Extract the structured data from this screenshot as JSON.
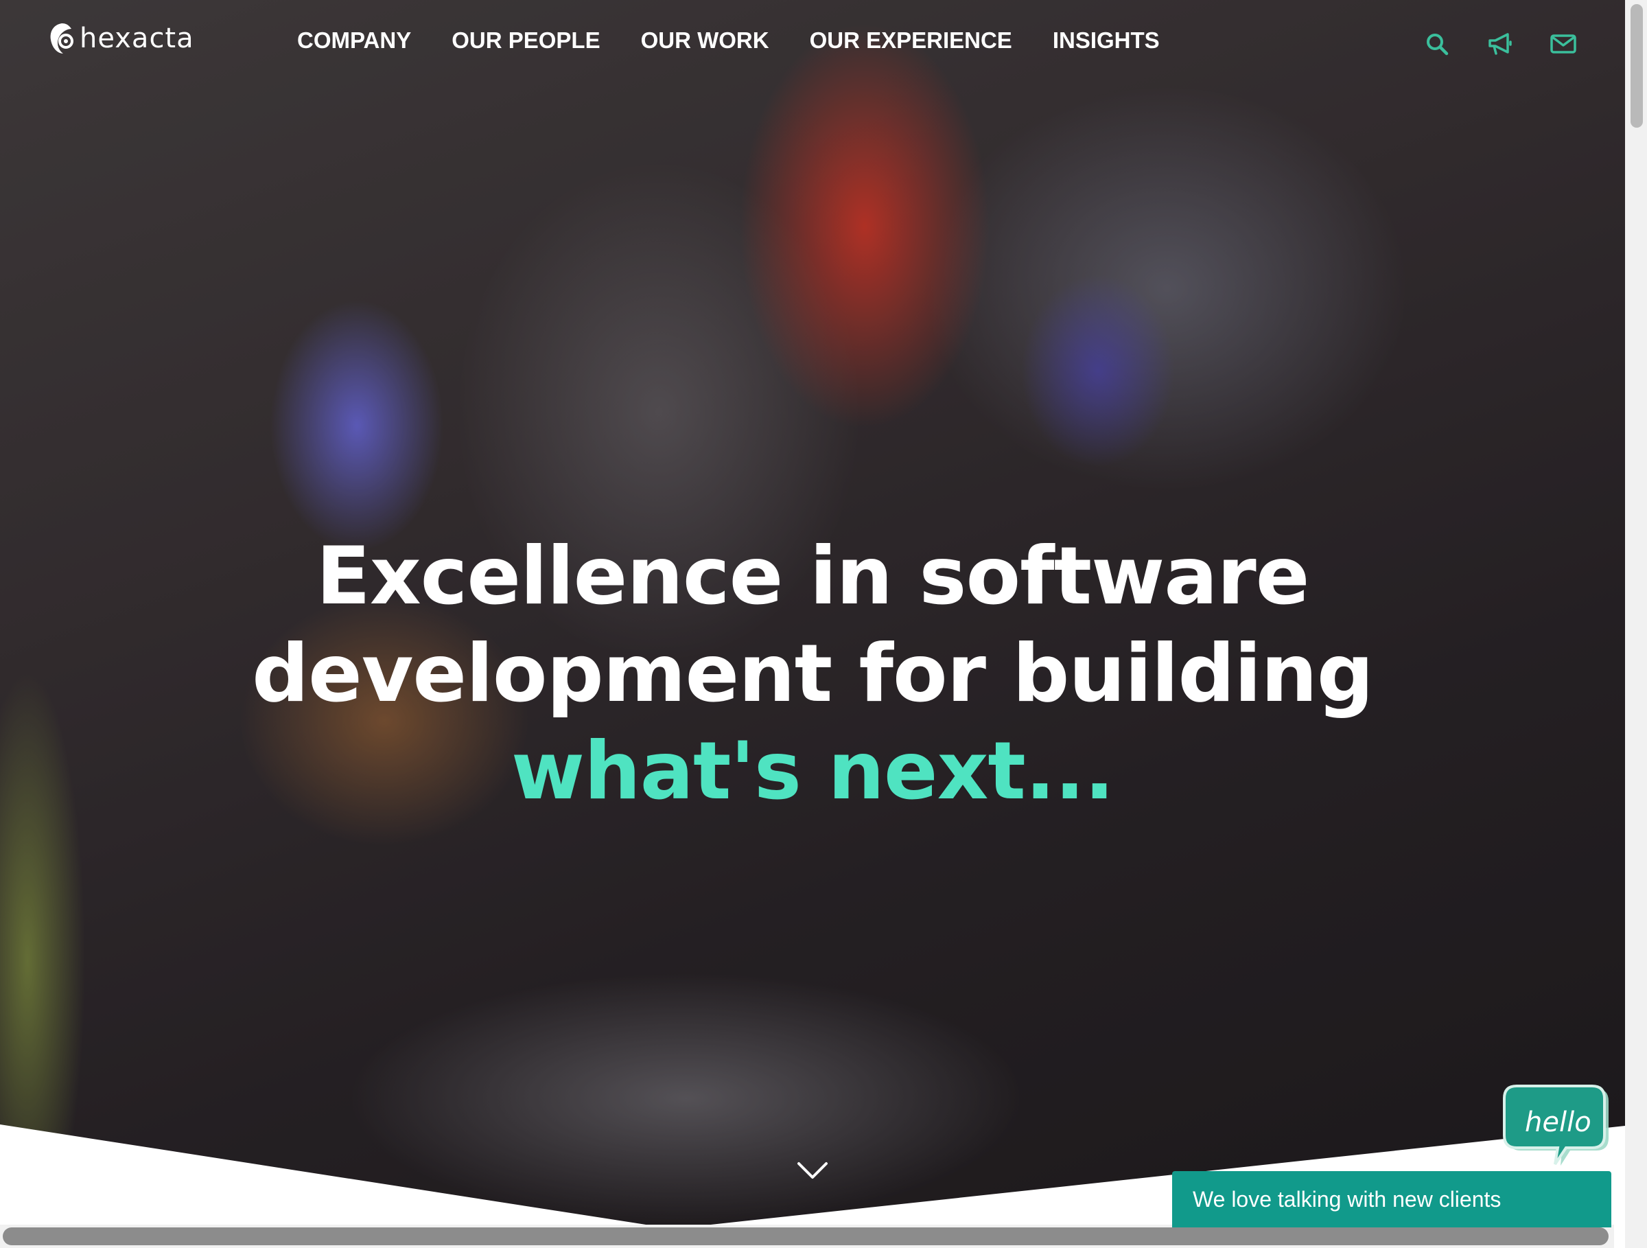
{
  "brand": {
    "logo_text": "hexacta"
  },
  "nav": {
    "items": [
      {
        "label": "COMPANY"
      },
      {
        "label": "OUR PEOPLE"
      },
      {
        "label": "OUR WORK"
      },
      {
        "label": "OUR EXPERIENCE"
      },
      {
        "label": "INSIGHTS"
      }
    ],
    "icons": [
      "search-icon",
      "megaphone-icon",
      "envelope-icon"
    ]
  },
  "hero": {
    "line1": "Excellence in software",
    "line2": "development for building",
    "line3": "what's next..."
  },
  "chat": {
    "bubble_text": "hello",
    "bar_text": "We love talking with new clients"
  },
  "colors": {
    "accent": "#4fe3c1",
    "icon": "#3bbf9c",
    "chat": "#119a8b"
  }
}
